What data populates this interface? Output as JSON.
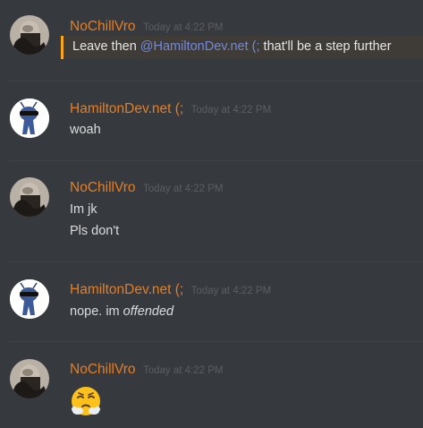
{
  "messages": [
    {
      "username": "NoChillVro",
      "timestamp": "Today at 4:22 PM",
      "avatar": "nochillvro-avatar",
      "lines": [],
      "mention_line": {
        "before": "Leave then ",
        "mention": "@HamiltonDev.net (;",
        "after": " that'll be a step further"
      }
    },
    {
      "username": "HamiltonDev.net (;",
      "timestamp": "Today at 4:22 PM",
      "avatar": "hamiltondev-avatar",
      "lines": [
        "woah"
      ]
    },
    {
      "username": "NoChillVro",
      "timestamp": "Today at 4:22 PM",
      "avatar": "nochillvro-avatar",
      "lines": [
        "Im jk",
        "Pls don't"
      ]
    },
    {
      "username": "HamiltonDev.net (;",
      "timestamp": "Today at 4:22 PM",
      "avatar": "hamiltondev-avatar",
      "lines": [],
      "rich_line": {
        "plain": "nope. im ",
        "italic": "offended"
      }
    },
    {
      "username": "NoChillVro",
      "timestamp": "Today at 4:22 PM",
      "avatar": "nochillvro-avatar",
      "lines": [],
      "emoji": "face-with-steam-from-nose-emoji"
    }
  ],
  "colors": {
    "background": "#36393e",
    "username": "#e67e22",
    "timestamp": "#5b5e63",
    "text": "#dcddde",
    "mention": "#7289da",
    "mention_highlight_border": "#faa61a",
    "mention_highlight_bg": "#3f3c37",
    "divider": "#3f4247"
  }
}
